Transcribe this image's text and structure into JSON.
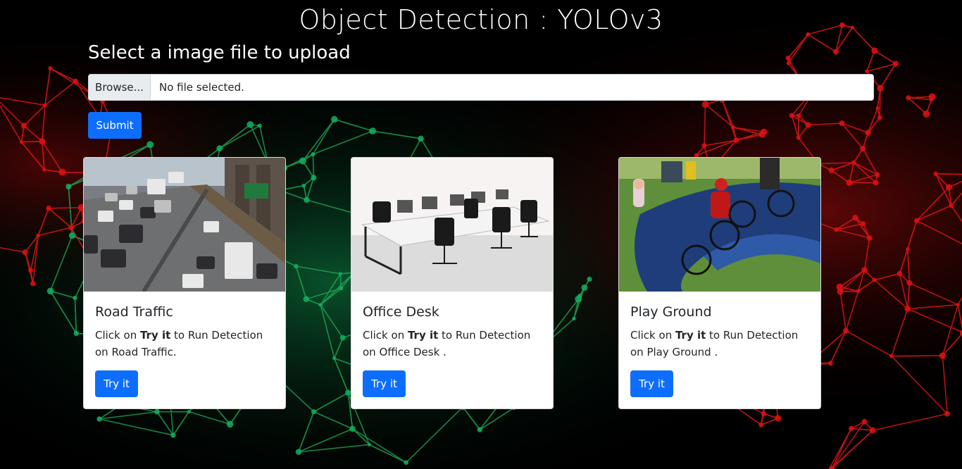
{
  "page": {
    "title": "Object Detection : YOLOv3",
    "upload_heading": "Select a image file to upload"
  },
  "upload": {
    "browse_label": "Browse...",
    "status_text": "No file selected.",
    "submit_label": "Submit"
  },
  "cards": [
    {
      "title": "Road Traffic",
      "text_prefix": "Click on ",
      "text_bold": "Try it",
      "text_suffix": " to Run Detection on Road Traffic.",
      "button_label": "Try it",
      "image_icon": "road-traffic-photo"
    },
    {
      "title": "Office Desk",
      "text_prefix": "Click on ",
      "text_bold": "Try it",
      "text_suffix": " to Run Detection on Office Desk .",
      "button_label": "Try it",
      "image_icon": "office-desk-photo"
    },
    {
      "title": "Play Ground",
      "text_prefix": "Click on ",
      "text_bold": "Try it",
      "text_suffix": " to Run Detection on Play Ground .",
      "button_label": "Try it",
      "image_icon": "playground-photo"
    }
  ],
  "colors": {
    "primary": "#0d6efd",
    "background": "#000000",
    "network_red": "#e01010",
    "network_green": "#10b060"
  }
}
